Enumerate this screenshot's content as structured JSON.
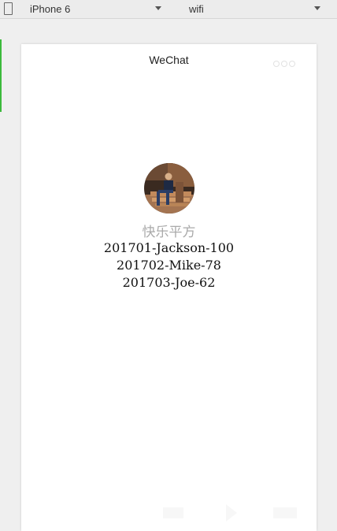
{
  "toolbar": {
    "device": "iPhone 6",
    "network": "wifi"
  },
  "page": {
    "title": "WeChat",
    "nickname": "快乐平方",
    "records": [
      "201701-Jackson-100",
      "201702-Mike-78",
      "201703-Joe-62"
    ]
  },
  "icons": {
    "device_icon": "device-phone-icon",
    "caret": "chevron-down-icon",
    "capsule": "more-dots-icon"
  },
  "colors": {
    "accent": "#3cba3c",
    "nickname": "#aaaaaa"
  }
}
